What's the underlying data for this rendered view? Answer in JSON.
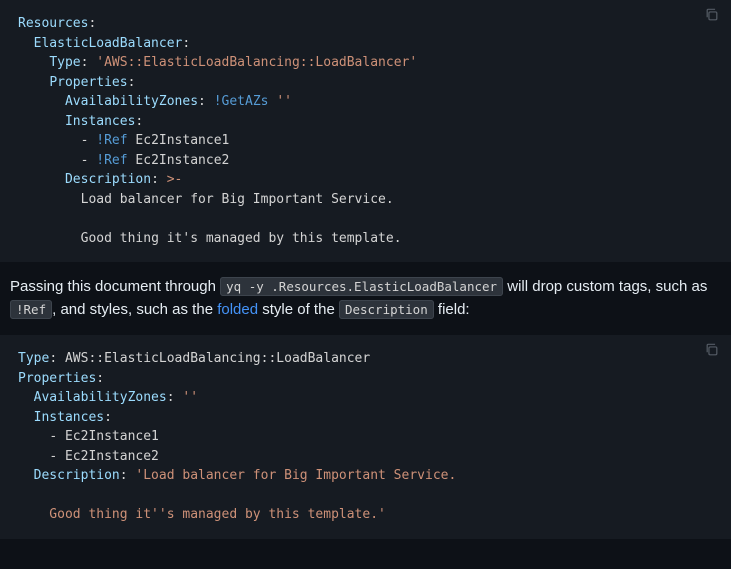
{
  "code1": {
    "l1": {
      "k": "Resources",
      "p": ":"
    },
    "l2": {
      "k": "ElasticLoadBalancer",
      "p": ":"
    },
    "l3": {
      "k": "Type",
      "p": ": ",
      "s": "'AWS::ElasticLoadBalancing::LoadBalancer'"
    },
    "l4": {
      "k": "Properties",
      "p": ":"
    },
    "l5": {
      "k": "AvailabilityZones",
      "p": ": ",
      "t": "!GetAZs",
      "sp": " ",
      "s": "''"
    },
    "l6": {
      "k": "Instances",
      "p": ":"
    },
    "l7": {
      "d": "- ",
      "t": "!Ref",
      "sp": " ",
      "v": "Ec2Instance1"
    },
    "l8": {
      "d": "- ",
      "t": "!Ref",
      "sp": " ",
      "v": "Ec2Instance2"
    },
    "l9": {
      "k": "Description",
      "p": ": ",
      "fold": ">-"
    },
    "l10": {
      "txt": "Load balancer for Big Important Service."
    },
    "l11": {
      "txt": "Good thing it's managed by this template."
    }
  },
  "prose1": {
    "t1": "Passing this document through ",
    "code1": "yq -y .Resources.ElasticLoadBalancer",
    "t2": " will drop custom tags, such as ",
    "code2": "!Ref",
    "t3": ", and styles, such as the ",
    "link": "folded",
    "t4": " style of the ",
    "code3": "Description",
    "t5": " field:"
  },
  "code2": {
    "l1": {
      "k": "Type",
      "p": ": ",
      "v": "AWS::ElasticLoadBalancing::LoadBalancer"
    },
    "l2": {
      "k": "Properties",
      "p": ":"
    },
    "l3": {
      "k": "AvailabilityZones",
      "p": ": ",
      "s": "''"
    },
    "l4": {
      "k": "Instances",
      "p": ":"
    },
    "l5": {
      "d": "- ",
      "v": "Ec2Instance1"
    },
    "l6": {
      "d": "- ",
      "v": "Ec2Instance2"
    },
    "l7": {
      "k": "Description",
      "p": ": ",
      "s": "'Load balancer for Big Important Service."
    },
    "l8": {
      "s": "  Good thing it''s managed by this template.'"
    }
  }
}
